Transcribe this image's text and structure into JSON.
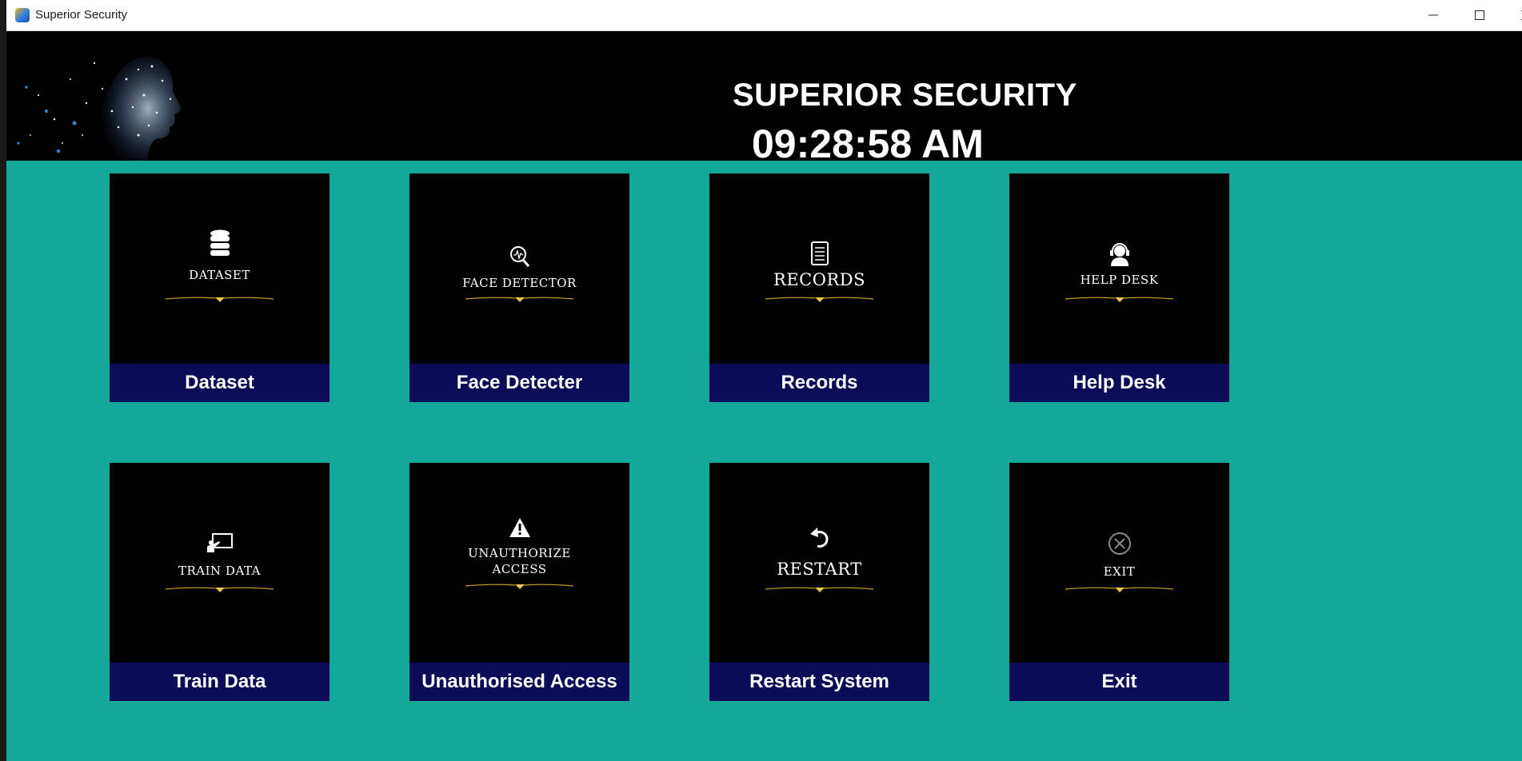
{
  "window": {
    "title": "Superior Security",
    "controls": {
      "minimize": "–",
      "maximize": "☐",
      "close": "✕"
    }
  },
  "header": {
    "title": "SUPERIOR SECURITY",
    "clock": "09:28:58 AM"
  },
  "tiles": [
    {
      "inner_label": "DATASET",
      "caption": "Dataset",
      "icon": "database-icon"
    },
    {
      "inner_label": "FACE DETECTOR",
      "caption": "Face Detecter",
      "icon": "face-search-icon"
    },
    {
      "inner_label": "RECORDS",
      "caption": "Records",
      "icon": "checklist-icon"
    },
    {
      "inner_label": "HELP DESK",
      "caption": "Help Desk",
      "icon": "support-agent-icon"
    },
    {
      "inner_label": "TRAIN DATA",
      "caption": "Train Data",
      "icon": "training-icon"
    },
    {
      "inner_label": "UNAUTHORIZE ACCESS",
      "caption": "Unauthorised Access",
      "icon": "warning-icon"
    },
    {
      "inner_label": "RESTART",
      "caption": "Restart System",
      "icon": "restart-icon"
    },
    {
      "inner_label": "EXIT",
      "caption": "Exit",
      "icon": "exit-icon"
    }
  ],
  "colors": {
    "background": "#13a89a",
    "header": "#000000",
    "caption_bar": "#0b0b58",
    "ornament": "#c9a227"
  }
}
